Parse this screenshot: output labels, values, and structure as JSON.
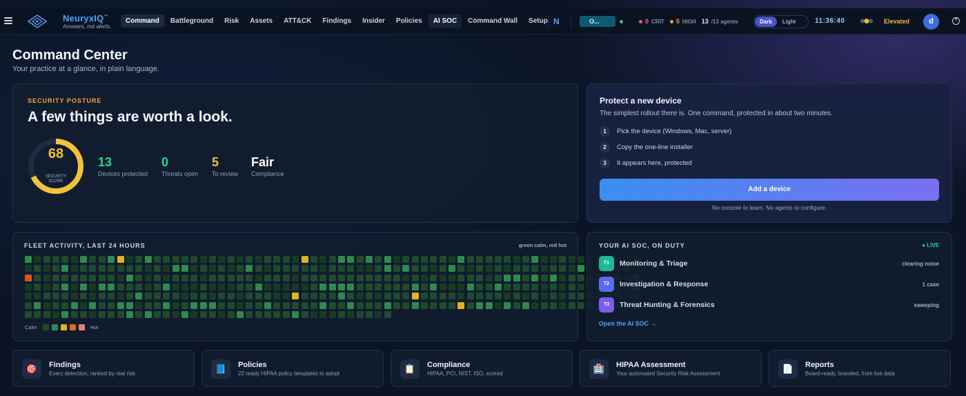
{
  "app": {
    "brand_name": "NeuryxIQ",
    "brand_trademark": "™",
    "brand_tagline": "Answers, not alerts."
  },
  "nav": [
    {
      "label": "Command",
      "active": true
    },
    {
      "label": "Battleground"
    },
    {
      "label": "Risk"
    },
    {
      "label": "Assets"
    },
    {
      "label": "ATT&CK"
    },
    {
      "label": "Findings"
    },
    {
      "label": "Insider"
    },
    {
      "label": "Policies"
    },
    {
      "label": "AI SOC"
    },
    {
      "label": "Command Wall"
    },
    {
      "label": "Setup"
    }
  ],
  "topbar": {
    "n_button": "N",
    "chip_label": "O...",
    "crit_count": "0",
    "crit_label": "CRIT",
    "high_count": "5",
    "high_label": "HIGH",
    "agents_count": "13",
    "agents_total": "/13 agents",
    "theme_dark": "Dark",
    "theme_light": "Light",
    "clock": "11:36:40",
    "elevated": "Elevated",
    "avatar_letter": "d",
    "help_glyph": "?",
    "colors": {
      "accent": "#4fa3ff",
      "crit": "#ff5a4f",
      "high": "#ff9b3a",
      "elevated": "#f4b73b"
    }
  },
  "header": {
    "title": "Command Center",
    "subtitle": "Your practice at a glance, in plain language."
  },
  "posture": {
    "eyebrow": "SECURITY POSTURE",
    "headline": "A few things are worth a look.",
    "score": "68",
    "score_label_1": "SECURITY",
    "score_label_2": "SCORE",
    "score_fraction": 0.68,
    "stats": [
      {
        "value": "13",
        "label": "Devices protected",
        "color": "#2bd48a"
      },
      {
        "value": "0",
        "label": "Threats open",
        "color": "#2bd48a"
      },
      {
        "value": "5",
        "label": "To review",
        "color": "#f4c13b"
      },
      {
        "value": "Fair",
        "label": "Compliance",
        "color": "#ffffff"
      }
    ]
  },
  "protect": {
    "title": "Protect a new device",
    "subtitle": "The simplest rollout there is. One command, protected in about two minutes.",
    "steps": [
      {
        "num": "1",
        "text": "Pick the device (Windows, Mac, server)"
      },
      {
        "num": "2",
        "text": "Copy the one-line installer"
      },
      {
        "num": "3",
        "text": "It appears here, protected"
      }
    ],
    "button": "Add a device",
    "note": "No console to learn. No agents to configure."
  },
  "fleet": {
    "eyebrow": "FLEET ACTIVITY, LAST 24 HOURS",
    "legend_top": "green calm, red hot",
    "legend_calm": "Calm",
    "legend_hot": "Hot",
    "legend_colors": [
      "#1f4a2e",
      "#2e8a4d",
      "#e2b21f",
      "#e06c1f",
      "#f07a7a"
    ],
    "palette": {
      "0": "#173a24",
      "1": "#1f4a2e",
      "2": "#2e8a4d",
      "3": "#e2b21f",
      "4": "#d9541c"
    },
    "grid": [
      "2011102112301211111010101011103101221212011111021111101200100112011",
      "0101201111111010220101012101111101110012121101210101011101102001120",
      "4101111111021010111011111011101111111111101010011101221212011101112",
      "0101202022111012000100011200000122221111112120002112111101010011112",
      "0011101011012111101101101110031111210101113111101111010101011111101",
      "1201120211220112012221101121111121121112112111131220212011011101102",
      "1110211011121211020110121111121000101101"
    ]
  },
  "soc": {
    "eyebrow": "YOUR AI SOC, ON DUTY",
    "live": "● LIVE",
    "tiers": [
      {
        "badge": "T1",
        "name": "Monitoring & Triage",
        "status": "clearing noise",
        "color": "#1fb896"
      },
      {
        "badge": "T2",
        "name": "Investigation & Response",
        "status": "1 case",
        "color": "#5b6cf0"
      },
      {
        "badge": "T3",
        "name": "Threat Hunting & Forensics",
        "status": "sweeping",
        "color": "#7a5cf0"
      }
    ],
    "link": "Open the AI SOC →"
  },
  "tiles": [
    {
      "icon": "target-icon",
      "glyph": "🎯",
      "title": "Findings",
      "subtitle": "Every detection, ranked by real risk"
    },
    {
      "icon": "book-icon",
      "glyph": "📘",
      "title": "Policies",
      "subtitle": "22 ready HIPAA policy templates to adopt"
    },
    {
      "icon": "clipboard-icon",
      "glyph": "📋",
      "title": "Compliance",
      "subtitle": "HIPAA, PCI, NIST, ISO, scored"
    },
    {
      "icon": "hospital-icon",
      "glyph": "🏥",
      "title": "HIPAA Assessment",
      "subtitle": "Your automated Security Risk Assessment"
    },
    {
      "icon": "document-icon",
      "glyph": "📄",
      "title": "Reports",
      "subtitle": "Board-ready, branded, from live data"
    }
  ]
}
